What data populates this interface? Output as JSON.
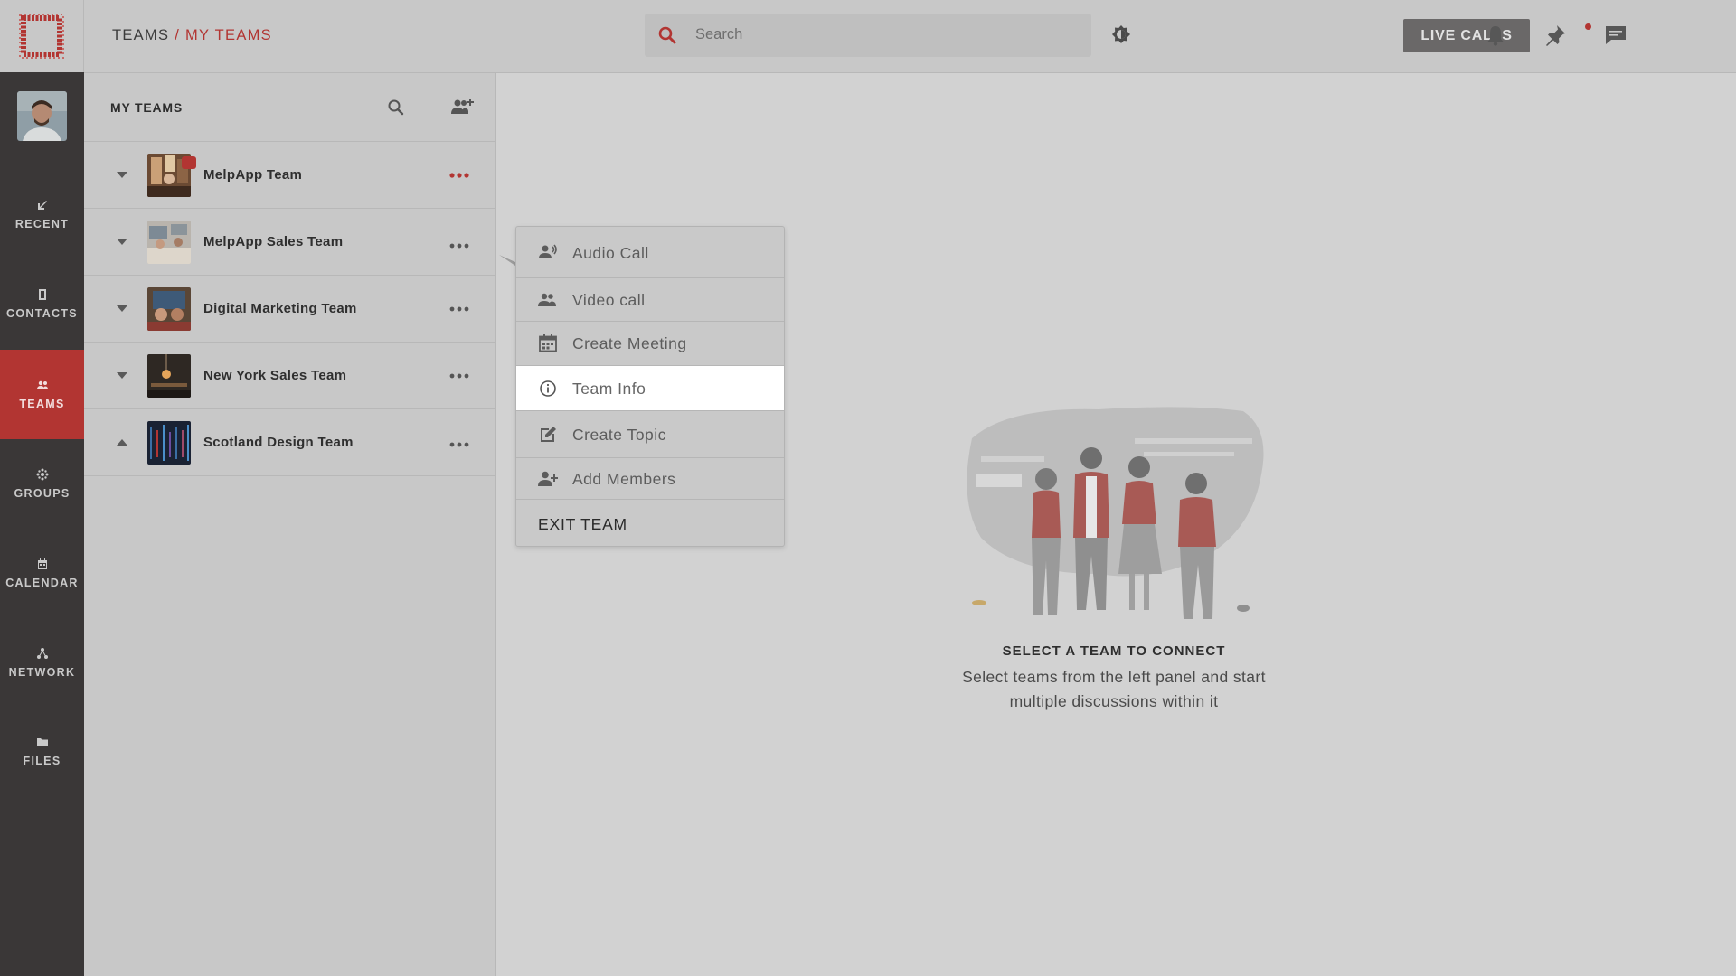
{
  "breadcrumb": {
    "root": "TEAMS",
    "separator": " / ",
    "current": "MY TEAMS"
  },
  "search": {
    "placeholder": "Search"
  },
  "header": {
    "live_calls_label": "LIVE CALLS"
  },
  "nav": [
    {
      "id": "recent",
      "label": "RECENT",
      "icon": "arrow-down-left-icon"
    },
    {
      "id": "contacts",
      "label": "CONTACTS",
      "icon": "contact-book-icon"
    },
    {
      "id": "teams",
      "label": "TEAMS",
      "icon": "people-icon",
      "active": true
    },
    {
      "id": "groups",
      "label": "GROUPS",
      "icon": "groups-icon"
    },
    {
      "id": "calendar",
      "label": "CALENDAR",
      "icon": "calendar-icon"
    },
    {
      "id": "network",
      "label": "NETWORK",
      "icon": "network-icon"
    },
    {
      "id": "files",
      "label": "FILES",
      "icon": "folder-icon"
    }
  ],
  "panel": {
    "title": "MY TEAMS",
    "teams": [
      {
        "name": "MelpApp Team",
        "expanded": false,
        "has_badge": true,
        "menu_open": true
      },
      {
        "name": "MelpApp Sales Team",
        "expanded": false
      },
      {
        "name": "Digital Marketing Team",
        "expanded": false
      },
      {
        "name": "New York Sales Team",
        "expanded": false
      },
      {
        "name": "Scotland Design Team",
        "expanded": true
      }
    ]
  },
  "menu": {
    "items": [
      {
        "label": "Audio Call",
        "icon": "audio-call-icon"
      },
      {
        "label": "Video call",
        "icon": "video-call-icon"
      },
      {
        "label": "Create Meeting",
        "icon": "calendar-icon"
      },
      {
        "label": "Team Info",
        "icon": "info-icon",
        "highlighted": true
      },
      {
        "label": "Create Topic",
        "icon": "edit-note-icon"
      },
      {
        "label": "Add Members",
        "icon": "add-person-icon"
      },
      {
        "label": "EXIT TEAM"
      }
    ]
  },
  "empty_state": {
    "title": "SELECT A TEAM TO CONNECT",
    "line1": "Select teams from the left panel and start",
    "line2": "multiple discussions within it"
  },
  "colors": {
    "accent": "#b23532",
    "rail": "#3a3737",
    "overlay_bg": "#c8c8c8",
    "highlight": "#ffffff"
  }
}
